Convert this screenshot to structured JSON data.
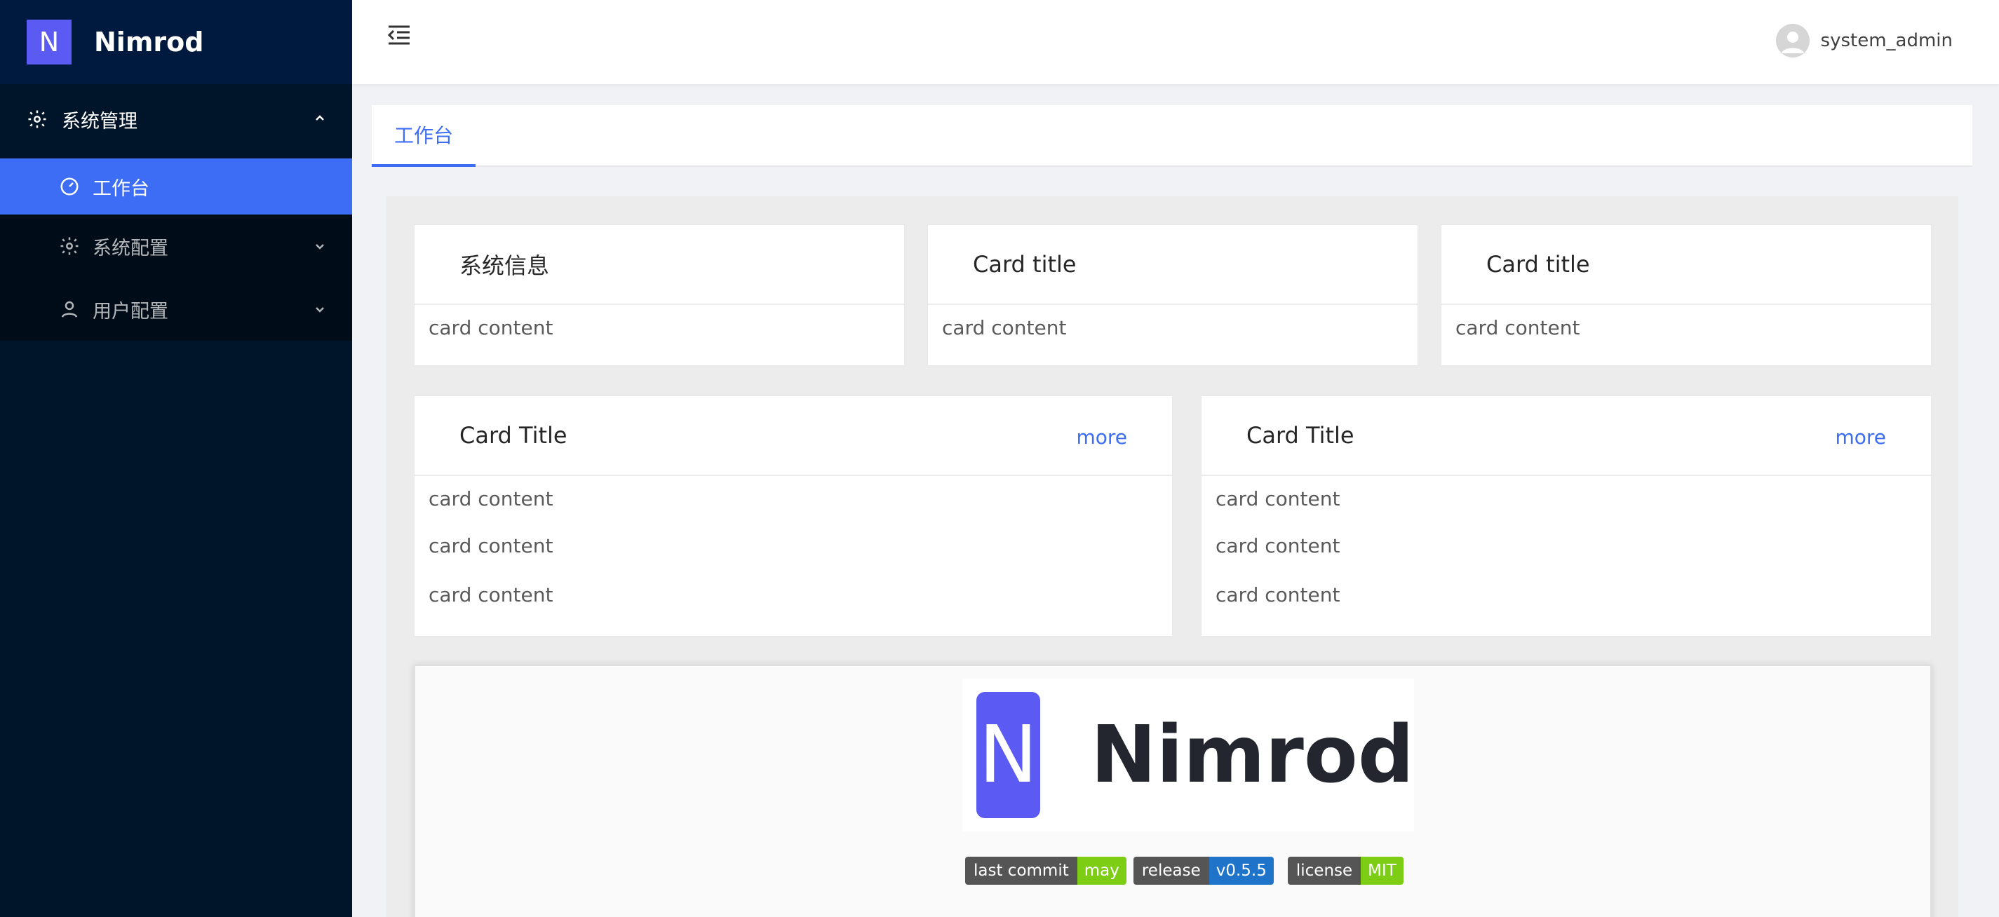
{
  "app": {
    "logo_letter": "N",
    "logo_text": "Nimrod"
  },
  "sidebar": {
    "group_label": "系统管理",
    "items": [
      {
        "label": "工作台",
        "icon": "dashboard-icon",
        "active": true
      },
      {
        "label": "系统配置",
        "icon": "gear-icon",
        "active": false
      },
      {
        "label": "用户配置",
        "icon": "user-icon",
        "active": false
      }
    ]
  },
  "header": {
    "username": "system_admin"
  },
  "tabs": [
    {
      "label": "工作台"
    }
  ],
  "cards_row1": [
    {
      "title": "系统信息",
      "content": "card content"
    },
    {
      "title": "Card title",
      "content": "card content"
    },
    {
      "title": "Card title",
      "content": "card content"
    }
  ],
  "cards_row2": [
    {
      "title": "Card Title",
      "more": "more",
      "lines": [
        "card content",
        "card content",
        "card content"
      ]
    },
    {
      "title": "Card Title",
      "more": "more",
      "lines": [
        "card content",
        "card content",
        "card content"
      ]
    }
  ],
  "readme": {
    "logo_letter": "N",
    "logo_text": "Nimrod",
    "badges": [
      {
        "label": "last commit",
        "value": "may",
        "color": "#4c1"
      },
      {
        "label": "release",
        "value": "v0.5.5",
        "color": "#007ec6"
      },
      {
        "label": "license",
        "value": "MIT",
        "color": "#4c1"
      }
    ]
  },
  "colors": {
    "primary": "#3d6df5",
    "sider_bg": "#001529",
    "logo": "#5b5bf4"
  }
}
